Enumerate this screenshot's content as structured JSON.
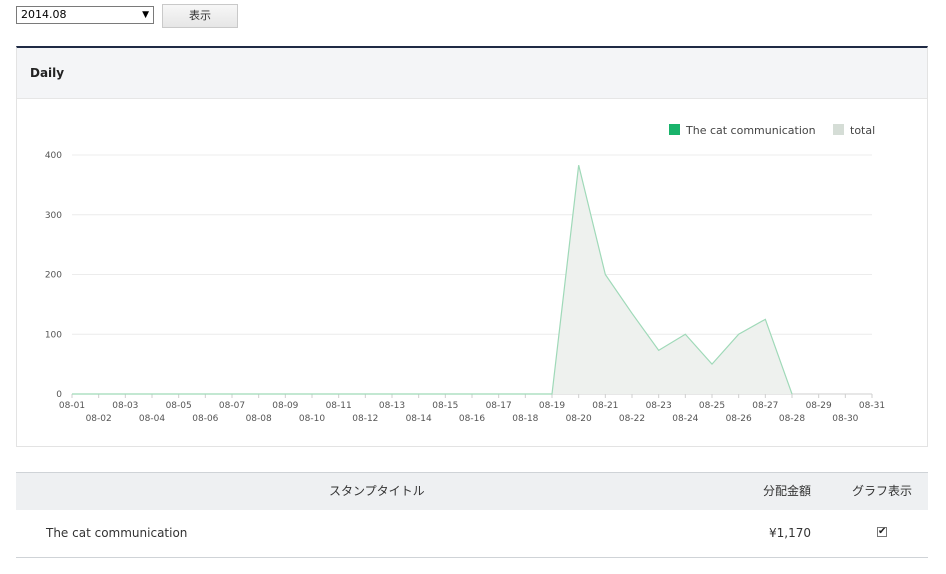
{
  "controls": {
    "month_value": "2014.08",
    "show_button_label": "表示"
  },
  "panel": {
    "title": "Daily"
  },
  "chart_data": {
    "type": "area",
    "x": [
      "08-01",
      "08-02",
      "08-03",
      "08-04",
      "08-05",
      "08-06",
      "08-07",
      "08-08",
      "08-09",
      "08-10",
      "08-11",
      "08-12",
      "08-13",
      "08-14",
      "08-15",
      "08-16",
      "08-17",
      "08-18",
      "08-19",
      "08-20",
      "08-21",
      "08-22",
      "08-23",
      "08-24",
      "08-25",
      "08-26",
      "08-27",
      "08-28",
      "08-29",
      "08-30",
      "08-31"
    ],
    "series": [
      {
        "name": "The cat communication",
        "color": "#19b36b",
        "values": [
          0,
          0,
          0,
          0,
          0,
          0,
          0,
          0,
          0,
          0,
          0,
          0,
          0,
          0,
          0,
          0,
          0,
          0,
          0,
          383,
          200,
          135,
          73,
          100,
          50,
          100,
          125,
          0,
          null,
          null,
          null
        ]
      },
      {
        "name": "total",
        "color": "#d5ddd6",
        "values": [
          0,
          0,
          0,
          0,
          0,
          0,
          0,
          0,
          0,
          0,
          0,
          0,
          0,
          0,
          0,
          0,
          0,
          0,
          0,
          383,
          200,
          135,
          73,
          100,
          50,
          100,
          125,
          0,
          null,
          null,
          null
        ]
      }
    ],
    "yticks": [
      0,
      100,
      200,
      300,
      400
    ],
    "ylim": [
      0,
      400
    ],
    "grid": true,
    "legend_position": "top-right"
  },
  "table": {
    "headers": {
      "title": "スタンプタイトル",
      "amount": "分配金額",
      "graph": "グラフ表示"
    },
    "rows": [
      {
        "title": "The cat communication",
        "amount": "¥1,170",
        "checked": true
      }
    ]
  }
}
